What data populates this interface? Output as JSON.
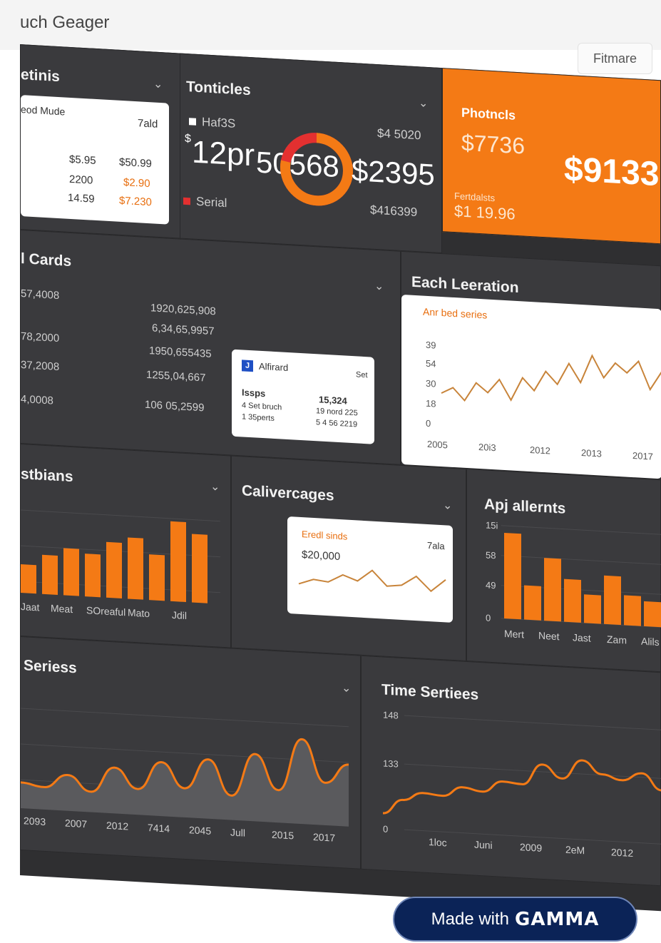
{
  "header": {
    "title": "uch Geager",
    "filter_label": "Fitmare"
  },
  "panels": {
    "settings": {
      "title": "etinis",
      "card": {
        "label": "eod Mude",
        "col2": "7ald",
        "rows": [
          [
            "$5.95",
            "$50.99"
          ],
          [
            "2200",
            "$2.90"
          ],
          [
            "14.59",
            "$7.230"
          ]
        ]
      }
    },
    "topics": {
      "title": "Tonticles",
      "legend": [
        "Haf3S",
        "Serial"
      ],
      "main_left": "12pr",
      "main_left_prefix": "$",
      "main_mid": "50568",
      "main_right": "$2395",
      "top_right": "$4 5020",
      "bottom_right": "$416399",
      "donut_fraction": 0.78
    },
    "products": {
      "title": "Photncls",
      "v1": "$7736",
      "v2": "$9133",
      "sub_label": "Fertdalsts",
      "sub_value": "$1 19.96"
    },
    "cards": {
      "title": "l Cards",
      "left_values": [
        "57,4008",
        "78,2000",
        "37,2008",
        "4,0008"
      ],
      "mid_values": [
        "1920,625,908",
        "6,34,65,9957",
        "1950,655435",
        "1255,04,667",
        "106 05,2599"
      ],
      "mini_card": {
        "icon": "J",
        "title": "Alfirard",
        "right": "Set",
        "label": "Issps",
        "value": "15,324",
        "sub1": "4 Set bruch",
        "sub2": "1 35perts",
        "sub3": "19 nord 225",
        "sub4": "5 4 56 2219"
      }
    },
    "each_leeration": {
      "title": "Each Leeration",
      "series_label": "Anr bed series"
    },
    "bars_left": {
      "title": "stbians"
    },
    "calivercages": {
      "title": "Calivercages",
      "card_label": "Eredl sinds",
      "card_right": "7ala",
      "card_value": "$20,000"
    },
    "api_alerts": {
      "title": "Apj allernts"
    },
    "series": {
      "title": "Seriess"
    },
    "time_series": {
      "title": "Time Sertiees"
    }
  },
  "chart_data": [
    {
      "type": "line",
      "title": "Anr bed series",
      "xlabel": "",
      "ylabel": "",
      "x": [
        "2005",
        "20i3",
        "2012",
        "2013",
        "2017"
      ],
      "y_ticks": [
        "0",
        "18",
        "30",
        "54",
        "39"
      ],
      "series": [
        {
          "values": [
            20,
            24,
            16,
            28,
            22,
            31,
            18,
            33,
            25,
            38,
            30,
            44,
            32,
            50,
            36,
            46,
            40,
            48,
            30,
            42
          ]
        }
      ]
    },
    {
      "type": "bar",
      "title": "",
      "categories": [
        "Jaat",
        "Meat",
        "SOreaful",
        "Mato",
        "Jdil"
      ],
      "series": [
        {
          "values": [
            40,
            55,
            66,
            60,
            78,
            86,
            64,
            112,
            96
          ]
        }
      ]
    },
    {
      "type": "line",
      "title": "Eredl sinds",
      "series": [
        {
          "values": [
            30,
            42,
            38,
            56,
            44,
            70,
            36,
            40,
            62,
            30,
            58
          ]
        }
      ]
    },
    {
      "type": "bar",
      "title": "",
      "categories": [
        "Mert",
        "Neet",
        "Jast",
        "Zam",
        "Alils"
      ],
      "y_ticks": [
        "0",
        "49",
        "58",
        "15i"
      ],
      "series": [
        {
          "values": [
            120,
            48,
            88,
            60,
            40,
            68,
            42,
            35
          ]
        }
      ]
    },
    {
      "type": "area",
      "title": "",
      "categories": [
        "2093",
        "2007",
        "2012",
        "7414",
        "2045",
        "Jull",
        "2015",
        "2017"
      ],
      "series": [
        {
          "values": [
            30,
            25,
            45,
            22,
            60,
            30,
            72,
            35,
            80,
            28,
            92,
            40,
            118,
            55,
            84
          ]
        }
      ]
    },
    {
      "type": "line",
      "title": "",
      "categories": [
        "1loc",
        "Juni",
        "2009",
        "2eM",
        "2012"
      ],
      "y_ticks": [
        "0",
        "133",
        "148"
      ],
      "series": [
        {
          "values": [
            12,
            30,
            40,
            38,
            50,
            46,
            60,
            58,
            84,
            68,
            92,
            76,
            70,
            80,
            60
          ]
        }
      ]
    }
  ],
  "branding": {
    "made_with": "Made with",
    "brand": "GAMMA"
  },
  "colors": {
    "accent": "#f47a15",
    "panel": "#3a3a3d",
    "background": "#2f2f31"
  }
}
